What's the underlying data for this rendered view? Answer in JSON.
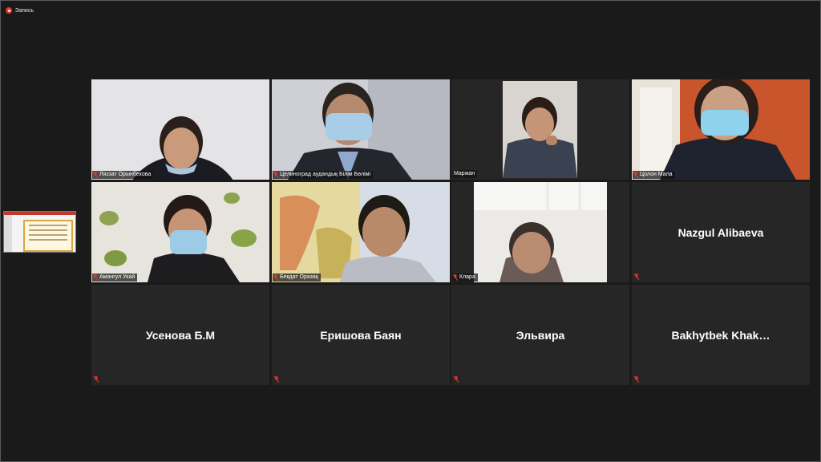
{
  "recording": {
    "label": "Запись",
    "icon": "record-icon"
  },
  "shared_screen": {
    "icon": "shared-slide-thumbnail"
  },
  "colors": {
    "background": "#1a1a1a",
    "tile": "#262626",
    "active_speaker_border": "#b8d43a",
    "muted_mic": "#e0392b"
  },
  "participants": [
    {
      "name": "Ляззат Орынбекова",
      "video": true,
      "muted": true
    },
    {
      "name": "Целиноград аудандық Білім Бөлімі",
      "video": true,
      "muted": true
    },
    {
      "name": "Маржан",
      "video": true,
      "muted": false,
      "active": true
    },
    {
      "name": "Цолон Мала",
      "video": true,
      "muted": true
    },
    {
      "name": "Амангул Укай",
      "video": true,
      "muted": true
    },
    {
      "name": "Бекдат Оразақ",
      "video": true,
      "muted": true
    },
    {
      "name": "Клара",
      "video": true,
      "muted": true
    },
    {
      "name": "Nazgul Alibaeva",
      "video": false,
      "muted": true
    },
    {
      "name": "Усенова Б.М",
      "video": false,
      "muted": true
    },
    {
      "name": "Еришова Баян",
      "video": false,
      "muted": true
    },
    {
      "name": "Эльвира",
      "video": false,
      "muted": true
    },
    {
      "name": "Bakhytbek  Khak…",
      "video": false,
      "muted": true
    }
  ]
}
